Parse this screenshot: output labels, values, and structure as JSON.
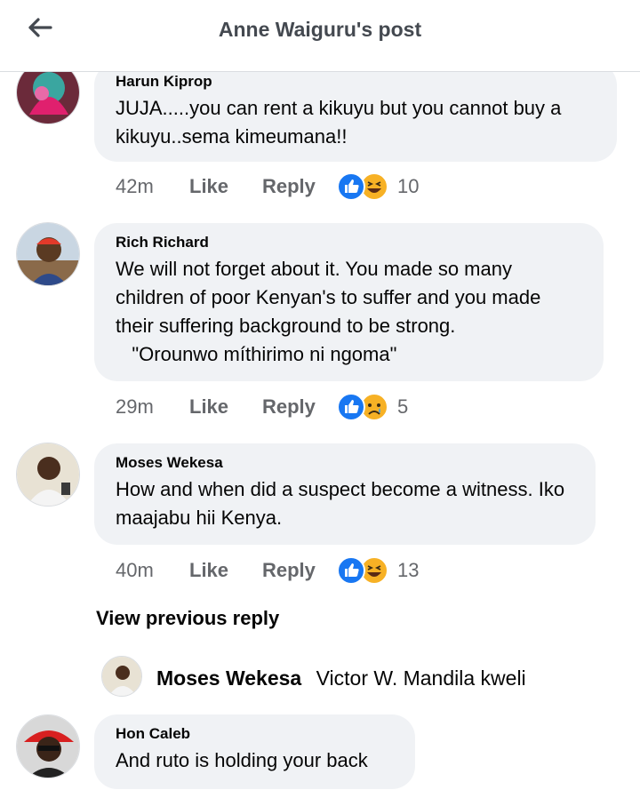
{
  "header": {
    "title": "Anne Waiguru's post",
    "back_icon": "back-arrow-icon"
  },
  "comments": [
    {
      "author": "Harun Kiprop",
      "text": "JUJA.....you can rent a kikuyu but you cannot buy a kikuyu..sema kimeumana!!",
      "time": "42m",
      "like": "Like",
      "reply": "Reply",
      "reactions": [
        "like",
        "haha"
      ],
      "count": "10"
    },
    {
      "author": "Rich Richard",
      "text": "We will not forget about it. You made so many children of poor Kenyan's to suffer and you made their suffering background to be strong.\n   \"Orounwo míthirimo ni ngoma\"",
      "time": "29m",
      "like": "Like",
      "reply": "Reply",
      "reactions": [
        "like",
        "sad"
      ],
      "count": "5"
    },
    {
      "author": "Moses Wekesa",
      "text": "How and when did a suspect become a witness. Iko maajabu hii Kenya.",
      "time": "40m",
      "like": "Like",
      "reply": "Reply",
      "reactions": [
        "like",
        "haha"
      ],
      "count": "13"
    },
    {
      "author": "Hon Caleb",
      "text": "And ruto is holding your back"
    }
  ],
  "view_previous": "View previous reply",
  "reply_preview": {
    "author": "Moses Wekesa",
    "text": "Victor W. Mandila kweli"
  },
  "colors": {
    "bubble": "#f0f2f5",
    "like_blue": "#1877f2",
    "emoji_yellow": "#f7b125",
    "meta_gray": "#65676b"
  }
}
